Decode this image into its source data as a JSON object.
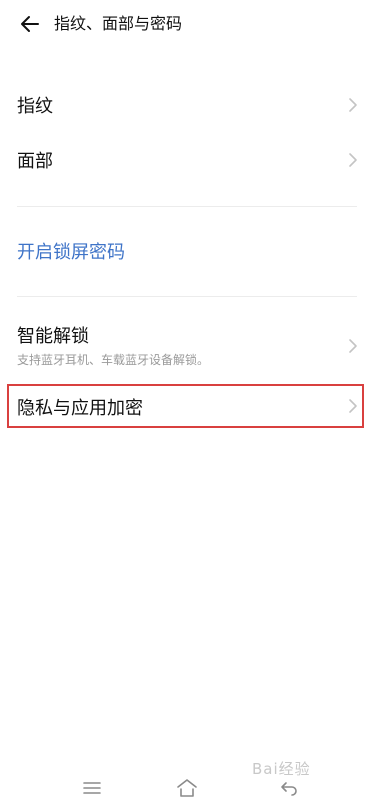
{
  "header": {
    "title": "指纹、面部与密码"
  },
  "items": [
    {
      "label": "指纹"
    },
    {
      "label": "面部"
    },
    {
      "label": "开启锁屏密码"
    },
    {
      "label": "智能解锁",
      "sub": "支持蓝牙耳机、车载蓝牙设备解锁。"
    },
    {
      "label": "隐私与应用加密"
    }
  ],
  "colors": {
    "accent": "#3f74c8",
    "highlight": "#d9403f",
    "text": "#111111",
    "subtext": "#9a9a9a"
  },
  "icons": [
    "back-arrow-icon",
    "chevron-right-icon",
    "menu-icon",
    "home-icon",
    "back-nav-icon"
  ],
  "watermark": "Bai经验"
}
